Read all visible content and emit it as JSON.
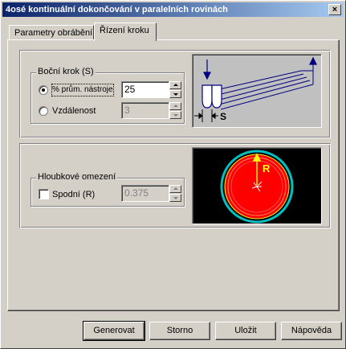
{
  "window": {
    "title": "4osé kontinuální dokončování v paralelních rovinách",
    "close_glyph": "×"
  },
  "tabs": [
    {
      "label": "Parametry obrábění",
      "active": false
    },
    {
      "label": "Řízení kroku",
      "active": true
    }
  ],
  "side_step": {
    "group_label": "Boční krok (S)",
    "option_percent_label": "% prům. nástroje",
    "option_percent_value": "25",
    "option_distance_label": "Vzdálenost",
    "option_distance_value": "3",
    "selected": "percent",
    "diagram_label": "S"
  },
  "depth_limit": {
    "group_label": "Hloubkové omezení",
    "checkbox_label": "Spodní (R)",
    "checked": false,
    "value": "0.375",
    "diagram_label": "R"
  },
  "buttons": {
    "generate": "Generovat",
    "cancel": "Storno",
    "save": "Uložit",
    "help": "Nápověda"
  },
  "colors": {
    "title_gradient_start": "#0a246a",
    "title_gradient_end": "#a6caf0",
    "dialog_bg": "#d4d0c8",
    "diagram_bg": "#c0c0c0",
    "diagram_ink": "#000080",
    "depth_bg": "#000000",
    "depth_disc": "#ff0000",
    "depth_ring": "#00c0c0",
    "depth_label": "#ffff00"
  }
}
